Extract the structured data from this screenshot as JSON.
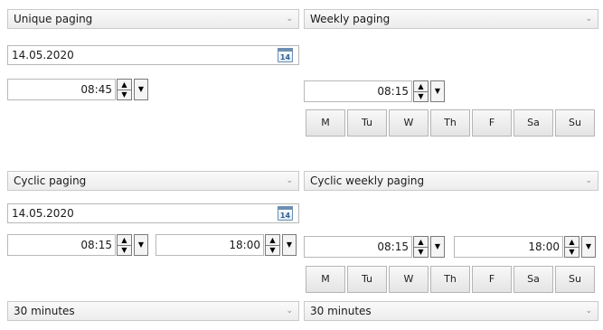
{
  "unique": {
    "select_value": "Unique paging",
    "date": "14.05.2020",
    "calendar_day": "14",
    "time": "08:45"
  },
  "weekly": {
    "select_value": "Weekly paging",
    "time": "08:15",
    "days": [
      "M",
      "Tu",
      "W",
      "Th",
      "F",
      "Sa",
      "Su"
    ]
  },
  "cyclic": {
    "select_value": "Cyclic paging",
    "date": "14.05.2020",
    "calendar_day": "14",
    "time_from": "08:15",
    "time_to": "18:00",
    "interval": "30 minutes"
  },
  "cyclic_weekly": {
    "select_value": "Cyclic weekly paging",
    "time_from": "08:15",
    "time_to": "18:00",
    "days": [
      "M",
      "Tu",
      "W",
      "Th",
      "F",
      "Sa",
      "Su"
    ],
    "interval": "30 minutes"
  },
  "icons": {
    "chevron": "⌄",
    "spin_up": "▲",
    "spin_down": "▼",
    "dropdown": "▼"
  }
}
